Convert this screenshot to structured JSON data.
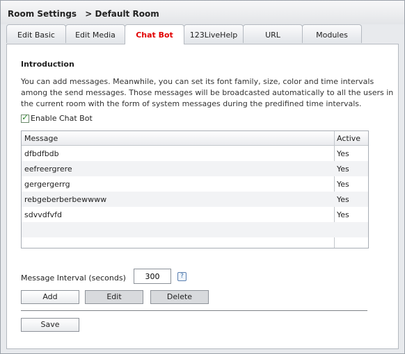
{
  "window": {
    "title": "Room Settings",
    "breadcrumb": "> Default Room"
  },
  "tabs": [
    {
      "label": "Edit Basic",
      "active": false
    },
    {
      "label": "Edit Media",
      "active": false
    },
    {
      "label": "Chat Bot",
      "active": true
    },
    {
      "label": "123LiveHelp",
      "active": false
    },
    {
      "label": "URL",
      "active": false
    },
    {
      "label": "Modules",
      "active": false
    }
  ],
  "intro": {
    "heading": "Introduction",
    "text": "You can add messages. Meanwhile, you can set its font family, size, color and time intervals among the send messages. Those messages will be broadcasted automatically to all the users in the current room with the form of system messages during the predifined time intervals."
  },
  "enable_chat_bot": {
    "label": "Enable Chat Bot",
    "checked": true,
    "check_glyph": "✓"
  },
  "grid": {
    "columns": [
      "Message",
      "Active"
    ],
    "rows": [
      {
        "message": "dfbdfbdb",
        "active": "Yes"
      },
      {
        "message": "eefreergrere",
        "active": "Yes"
      },
      {
        "message": "gergergerrg",
        "active": "Yes"
      },
      {
        "message": "rebgeberberbewwww",
        "active": "Yes"
      },
      {
        "message": "sdvvdfvfd",
        "active": "Yes"
      },
      {
        "message": "",
        "active": ""
      },
      {
        "message": "",
        "active": ""
      }
    ]
  },
  "interval": {
    "label": "Message Interval (seconds)",
    "value": "300",
    "help_glyph": "?"
  },
  "buttons": {
    "add": "Add",
    "edit": "Edit",
    "delete": "Delete",
    "save": "Save"
  },
  "colors": {
    "active_tab_text": "#e20000",
    "check": "#2e8b2e"
  }
}
